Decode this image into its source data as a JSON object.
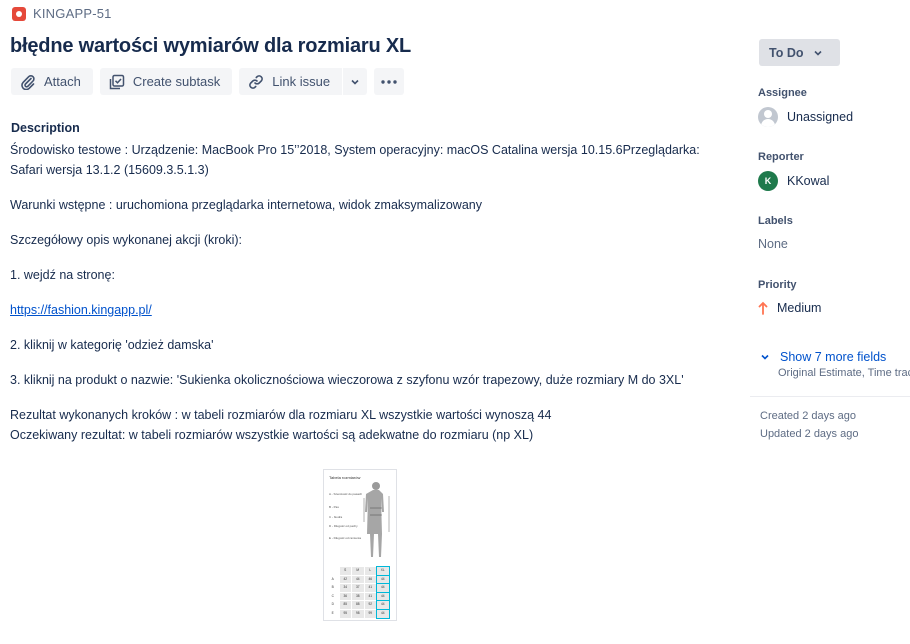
{
  "issue": {
    "key": "KINGAPP-51",
    "type_icon": "bug-icon",
    "summary": "błędne wartości wymiarów dla rozmiaru XL"
  },
  "toolbar": {
    "attach_label": "Attach",
    "create_subtask_label": "Create subtask",
    "link_issue_label": "Link issue"
  },
  "description": {
    "heading": "Description",
    "env_line1": "Środowisko testowe : Urządzenie: MacBook Pro 15’’2018, System operacyjny: macOS Catalina wersja 10.15.6Przeglądarka:",
    "env_line2": "Safari wersja 13.1.2 (15609.3.5.1.3)",
    "preconditions": "Warunki wstępne : uruchomiona przeglądarka internetowa, widok zmaksymalizowany",
    "steps_intro": "Szczegółowy opis wykonanej akcji (kroki):",
    "step1": "1. wejdź na stronę:",
    "step1_link": "https://fashion.kingapp.pl/",
    "step2": "2. kliknij w kategorię 'odzież damska'",
    "step3": "3. kliknij na produkt o nazwie: 'Sukienka okolicznościowa wieczorowa z szyfonu wzór trapezowy, duże rozmiary M do 3XL'",
    "result": "Rezultat wykonanych kroków : w tabeli rozmiarów dla rozmiaru XL wszystkie wartości wynoszą 44",
    "expected": "Oczekiwany rezultat: w tabeli rozmiarów wszystkie wartości są adekwatne do rozmiaru (np XL)"
  },
  "attachment": {
    "title": "Tabela rozmiarów",
    "labels": [
      "A - Szerokość do pasach",
      "B - Pas",
      "C - biodra",
      "D - Długość od pachy",
      "E - Długość od ramienia"
    ],
    "table_header": [
      "",
      "S",
      "M",
      "L",
      "XL"
    ],
    "table_rows": [
      [
        "A",
        "42",
        "44",
        "46",
        "44"
      ],
      [
        "B",
        "34",
        "37",
        "41",
        "44"
      ],
      [
        "C",
        "36",
        "38",
        "41",
        "44"
      ],
      [
        "D",
        "85",
        "88",
        "92",
        "44"
      ],
      [
        "E",
        "95",
        "98",
        "99",
        "44"
      ]
    ]
  },
  "sidebar": {
    "status_label": "To Do",
    "assignee_label": "Assignee",
    "assignee_value": "Unassigned",
    "reporter_label": "Reporter",
    "reporter_initial": "K",
    "reporter_value": "KKowal",
    "labels_label": "Labels",
    "labels_value": "None",
    "priority_label": "Priority",
    "priority_value": "Medium",
    "show_more": "Show 7 more fields",
    "show_more_sub": "Original Estimate, Time tracking",
    "created": "Created 2 days ago",
    "updated": "Updated 2 days ago"
  },
  "colors": {
    "accent": "#0052cc",
    "bug": "#e5493a",
    "priority_medium": "#ff7452",
    "reporter_avatar": "#1f7a4c",
    "xl_highlight": "#00b8d9"
  }
}
